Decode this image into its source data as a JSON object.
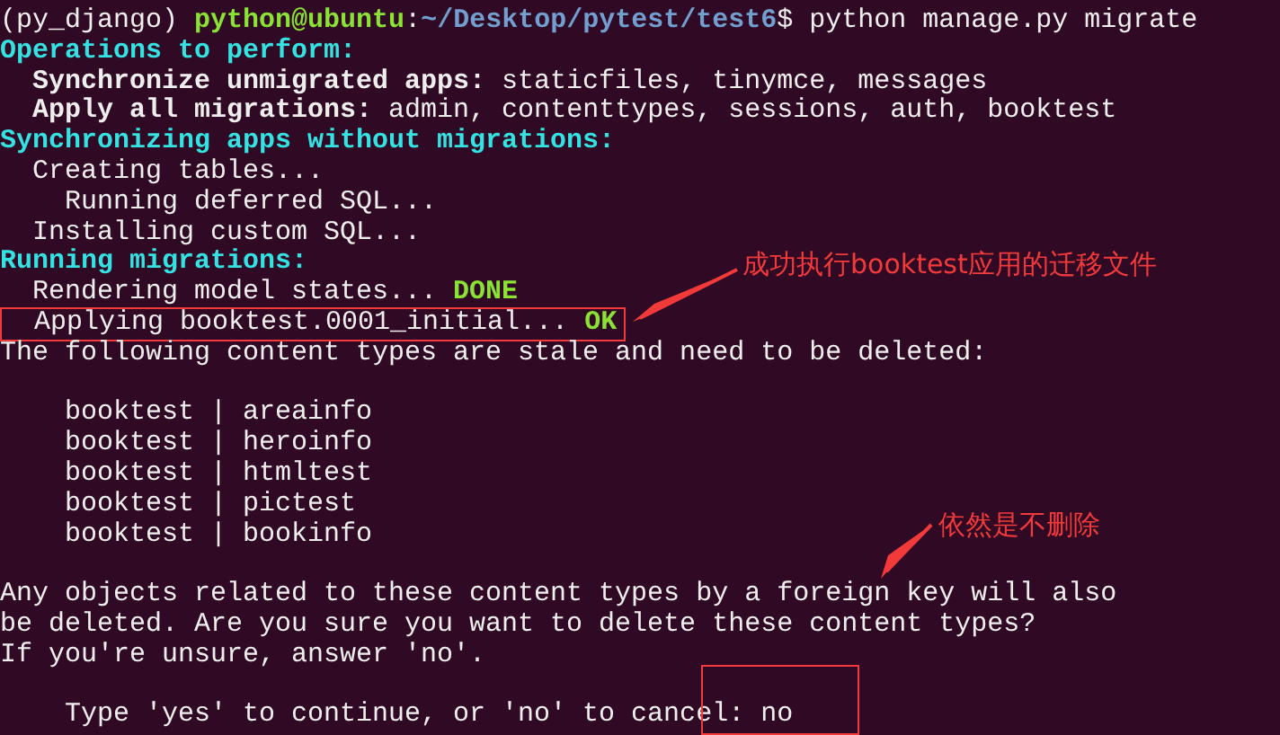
{
  "terminal": {
    "lines": [
      {
        "kind": "text",
        "highlighted": false,
        "segments": [
          {
            "kind": "plain",
            "text": "(py_django) "
          },
          {
            "kind": "user",
            "text": "python@ubuntu"
          },
          {
            "kind": "plain",
            "text": ":"
          },
          {
            "kind": "path",
            "text": "~/Desktop/pytest/test6"
          },
          {
            "kind": "plain",
            "text": "$ python manage.py migrate"
          }
        ]
      },
      {
        "kind": "text",
        "highlighted": false,
        "segments": [
          {
            "kind": "heading",
            "text": "Operations to perform:"
          }
        ]
      },
      {
        "kind": "text",
        "highlighted": false,
        "segments": [
          {
            "kind": "bold",
            "text": "  Synchronize unmigrated apps:"
          },
          {
            "kind": "plain",
            "text": " staticfiles, tinymce, messages"
          }
        ]
      },
      {
        "kind": "text",
        "highlighted": false,
        "segments": [
          {
            "kind": "bold",
            "text": "  Apply all migrations:"
          },
          {
            "kind": "plain",
            "text": " admin, contenttypes, sessions, auth, booktest"
          }
        ]
      },
      {
        "kind": "text",
        "highlighted": false,
        "segments": [
          {
            "kind": "heading",
            "text": "Synchronizing apps without migrations:"
          }
        ]
      },
      {
        "kind": "text",
        "highlighted": false,
        "segments": [
          {
            "kind": "plain",
            "text": "  Creating tables..."
          }
        ]
      },
      {
        "kind": "text",
        "highlighted": false,
        "segments": [
          {
            "kind": "plain",
            "text": "    Running deferred SQL..."
          }
        ]
      },
      {
        "kind": "text",
        "highlighted": false,
        "segments": [
          {
            "kind": "plain",
            "text": "  Installing custom SQL..."
          }
        ]
      },
      {
        "kind": "text",
        "highlighted": false,
        "segments": [
          {
            "kind": "heading",
            "text": "Running migrations:"
          }
        ]
      },
      {
        "kind": "text",
        "highlighted": false,
        "segments": [
          {
            "kind": "plain",
            "text": "  Rendering model states... "
          },
          {
            "kind": "success",
            "text": "DONE"
          }
        ]
      },
      {
        "kind": "text",
        "highlighted": true,
        "segments": [
          {
            "kind": "plain",
            "text": "  Applying booktest.0001_initial... "
          },
          {
            "kind": "success",
            "text": "OK"
          }
        ]
      },
      {
        "kind": "text",
        "highlighted": false,
        "segments": [
          {
            "kind": "plain",
            "text": "The following content types are stale and need to be deleted:"
          }
        ]
      },
      {
        "kind": "blank"
      },
      {
        "kind": "text",
        "highlighted": false,
        "segments": [
          {
            "kind": "plain",
            "text": "    booktest | areainfo"
          }
        ]
      },
      {
        "kind": "text",
        "highlighted": false,
        "segments": [
          {
            "kind": "plain",
            "text": "    booktest | heroinfo"
          }
        ]
      },
      {
        "kind": "text",
        "highlighted": false,
        "segments": [
          {
            "kind": "plain",
            "text": "    booktest | htmltest"
          }
        ]
      },
      {
        "kind": "text",
        "highlighted": false,
        "segments": [
          {
            "kind": "plain",
            "text": "    booktest | pictest"
          }
        ]
      },
      {
        "kind": "text",
        "highlighted": false,
        "segments": [
          {
            "kind": "plain",
            "text": "    booktest | bookinfo"
          }
        ]
      },
      {
        "kind": "blank"
      },
      {
        "kind": "text",
        "highlighted": false,
        "segments": [
          {
            "kind": "plain",
            "text": "Any objects related to these content types by a foreign key will also"
          }
        ]
      },
      {
        "kind": "text",
        "highlighted": false,
        "segments": [
          {
            "kind": "plain",
            "text": "be deleted. Are you sure you want to delete these content types?"
          }
        ]
      },
      {
        "kind": "text",
        "highlighted": false,
        "segments": [
          {
            "kind": "plain",
            "text": "If you're unsure, answer 'no'."
          }
        ]
      },
      {
        "kind": "blank"
      },
      {
        "kind": "text",
        "highlighted": false,
        "segments": [
          {
            "kind": "plain",
            "text": "    Type 'yes' to continue, or 'no' to cancel: no"
          }
        ]
      }
    ]
  },
  "annotations": [
    {
      "text": "成功执行booktest应用的迁移文件"
    },
    {
      "text": "依然是不删除"
    }
  ]
}
